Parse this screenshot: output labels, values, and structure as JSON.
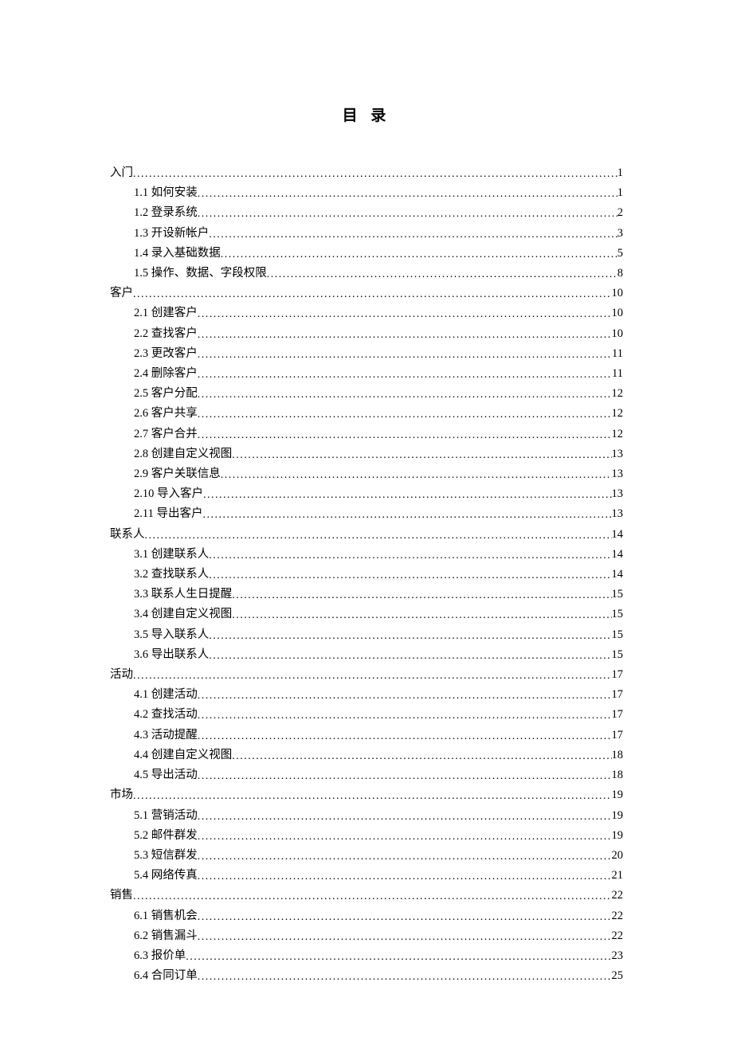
{
  "title": "目 录",
  "entries": [
    {
      "level": 0,
      "label": "入门",
      "page": "1"
    },
    {
      "level": 1,
      "label": "1.1  如何安装",
      "page": "1"
    },
    {
      "level": 1,
      "label": "1.2  登录系统",
      "page": "2"
    },
    {
      "level": 1,
      "label": "1.3  开设新帐户",
      "page": "3"
    },
    {
      "level": 1,
      "label": "1.4  录入基础数据",
      "page": "5"
    },
    {
      "level": 1,
      "label": "1.5 操作、数据、字段权限",
      "page": "8"
    },
    {
      "level": 0,
      "label": "客户",
      "page": "10"
    },
    {
      "level": 1,
      "label": "2.1  创建客户",
      "page": "10"
    },
    {
      "level": 1,
      "label": "2.2  查找客户",
      "page": "10"
    },
    {
      "level": 1,
      "label": "2.3  更改客户",
      "page": "11"
    },
    {
      "level": 1,
      "label": "2.4  删除客户",
      "page": "11"
    },
    {
      "level": 1,
      "label": "2.5  客户分配",
      "page": "12"
    },
    {
      "level": 1,
      "label": "2.6  客户共享",
      "page": "12"
    },
    {
      "level": 1,
      "label": "2.7  客户合并",
      "page": "12"
    },
    {
      "level": 1,
      "label": "2.8  创建自定义视图",
      "page": "13"
    },
    {
      "level": 1,
      "label": "2.9  客户关联信息",
      "page": "13"
    },
    {
      "level": 1,
      "label": "2.10 导入客户",
      "page": "13"
    },
    {
      "level": 1,
      "label": "2.11 导出客户",
      "page": "13"
    },
    {
      "level": 0,
      "label": "联系人",
      "page": "14"
    },
    {
      "level": 1,
      "label": "3.1  创建联系人",
      "page": "14"
    },
    {
      "level": 1,
      "label": "3.2  查找联系人",
      "page": "14"
    },
    {
      "level": 1,
      "label": "3.3  联系人生日提醒",
      "page": "15"
    },
    {
      "level": 1,
      "label": "3.4  创建自定义视图",
      "page": "15"
    },
    {
      "level": 1,
      "label": "3.5  导入联系人",
      "page": "15"
    },
    {
      "level": 1,
      "label": "3.6  导出联系人",
      "page": "15"
    },
    {
      "level": 0,
      "label": "活动",
      "page": "17"
    },
    {
      "level": 1,
      "label": "4.1  创建活动",
      "page": "17"
    },
    {
      "level": 1,
      "label": "4.2  查找活动",
      "page": "17"
    },
    {
      "level": 1,
      "label": "4.3  活动提醒",
      "page": "17"
    },
    {
      "level": 1,
      "label": "4.4  创建自定义视图",
      "page": "18"
    },
    {
      "level": 1,
      "label": "4.5  导出活动",
      "page": "18"
    },
    {
      "level": 0,
      "label": "市场",
      "page": "19"
    },
    {
      "level": 1,
      "label": "5.1  营销活动",
      "page": "19"
    },
    {
      "level": 1,
      "label": "5.2  邮件群发",
      "page": "19"
    },
    {
      "level": 1,
      "label": "5.3  短信群发",
      "page": "20"
    },
    {
      "level": 1,
      "label": "5.4  网络传真",
      "page": "21"
    },
    {
      "level": 0,
      "label": "销售",
      "page": "22"
    },
    {
      "level": 1,
      "label": "6.1  销售机会",
      "page": "22"
    },
    {
      "level": 1,
      "label": "6.2  销售漏斗",
      "page": "22"
    },
    {
      "level": 1,
      "label": "6.3  报价单",
      "page": "23"
    },
    {
      "level": 1,
      "label": "6.4  合同订单",
      "page": "25"
    }
  ]
}
